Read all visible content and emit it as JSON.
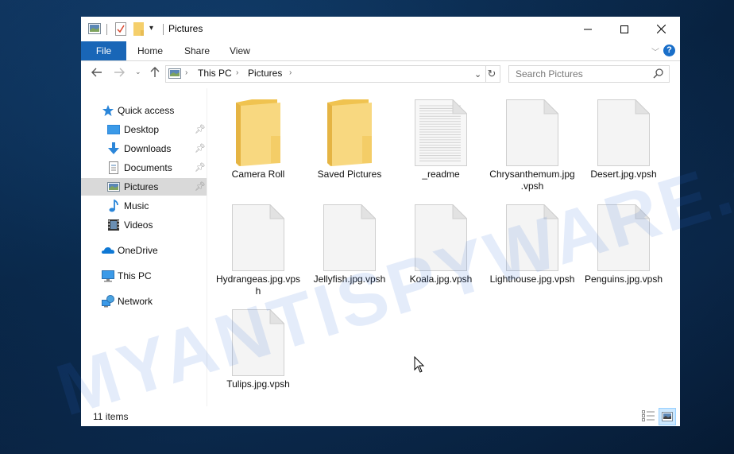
{
  "window": {
    "title": "Pictures",
    "controls": {
      "minimize": "minimize",
      "maximize": "maximize",
      "close": "close"
    }
  },
  "ribbon": {
    "tabs": [
      {
        "label": "File",
        "active": true
      },
      {
        "label": "Home"
      },
      {
        "label": "Share"
      },
      {
        "label": "View"
      }
    ],
    "help_label": "?"
  },
  "navigation": {
    "breadcrumb": [
      "This PC",
      "Pictures"
    ],
    "search_placeholder": "Search Pictures"
  },
  "sidebar": {
    "quick_access": {
      "label": "Quick access",
      "icon": "star-icon"
    },
    "pinned": [
      {
        "label": "Desktop",
        "icon": "desktop-icon",
        "pinned": true
      },
      {
        "label": "Downloads",
        "icon": "download-icon",
        "pinned": true
      },
      {
        "label": "Documents",
        "icon": "documents-icon",
        "pinned": true
      },
      {
        "label": "Pictures",
        "icon": "pictures-icon",
        "pinned": true,
        "selected": true
      },
      {
        "label": "Music",
        "icon": "music-icon",
        "pinned": false
      },
      {
        "label": "Videos",
        "icon": "videos-icon",
        "pinned": false
      }
    ],
    "roots": [
      {
        "label": "OneDrive",
        "icon": "cloud-icon"
      },
      {
        "label": "This PC",
        "icon": "computer-icon"
      },
      {
        "label": "Network",
        "icon": "network-icon"
      }
    ]
  },
  "files": [
    {
      "name": "Camera Roll",
      "type": "folder"
    },
    {
      "name": "Saved Pictures",
      "type": "folder"
    },
    {
      "name": "_readme",
      "type": "text"
    },
    {
      "name": "Chrysanthemum.jpg.vpsh",
      "type": "file"
    },
    {
      "name": "Desert.jpg.vpsh",
      "type": "file"
    },
    {
      "name": "Hydrangeas.jpg.vpsh",
      "type": "file"
    },
    {
      "name": "Jellyfish.jpg.vpsh",
      "type": "file"
    },
    {
      "name": "Koala.jpg.vpsh",
      "type": "file"
    },
    {
      "name": "Lighthouse.jpg.vpsh",
      "type": "file"
    },
    {
      "name": "Penguins.jpg.vpsh",
      "type": "file"
    },
    {
      "name": "Tulips.jpg.vpsh",
      "type": "file"
    }
  ],
  "status": {
    "item_count": "11 items",
    "view_mode": "large-icons"
  },
  "watermark": "MYANTISPYWARE.COM",
  "colors": {
    "accent": "#1966b7",
    "selected_nav": "#d9d9d9",
    "folder": "#f5cf6b"
  }
}
